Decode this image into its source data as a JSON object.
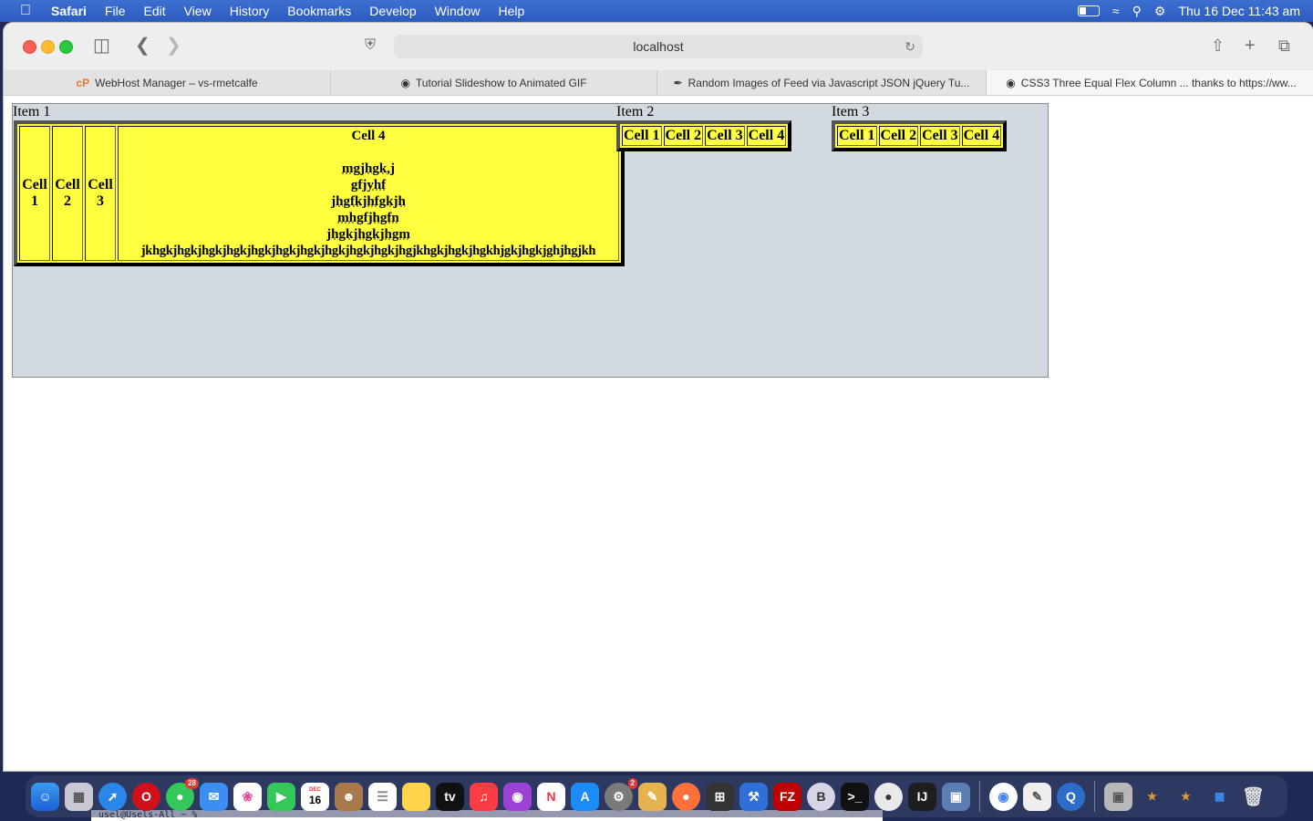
{
  "menubar": {
    "app": "Safari",
    "items": [
      "File",
      "Edit",
      "View",
      "History",
      "Bookmarks",
      "Develop",
      "Window",
      "Help"
    ],
    "clock": "Thu 16 Dec  11:43 am"
  },
  "toolbar": {
    "address": "localhost"
  },
  "tabs": [
    {
      "label": "WebHost Manager – vs-rmetcalfe",
      "favicon": "cP"
    },
    {
      "label": "Tutorial Slideshow to Animated GIF",
      "favicon": "github-icon"
    },
    {
      "label": "Random Images of Feed via Javascript JSON jQuery Tu...",
      "favicon": "feather-icon"
    },
    {
      "label": "CSS3 Three Equal Flex Column ... thanks to https://ww...",
      "favicon": "github-icon"
    }
  ],
  "page": {
    "columns": [
      {
        "label": "Item 1",
        "cells": [
          "Cell 1",
          "Cell 2",
          "Cell 3"
        ],
        "cell4_title": "Cell 4",
        "cell4_lines": [
          "mgjhgk,j",
          "gfjyhf",
          "jhgfkjhfgkjh",
          "mhgfjhgfn",
          "jhgkjhgkjhgm",
          "jkhgkjhgkjhgkjhgkjhgkjhgkjhgkjhgkjhgkjhgkjhgjkhgkjhgkjhgkhjgkjhgkjghjhgjkh"
        ]
      },
      {
        "label": "Item 2",
        "cells": [
          "Cell 1",
          "Cell 2",
          "Cell 3",
          "Cell 4"
        ]
      },
      {
        "label": "Item 3",
        "cells": [
          "Cell 1",
          "Cell 2",
          "Cell 3",
          "Cell 4"
        ]
      }
    ]
  },
  "dock": {
    "messages_badge": "28",
    "calendar_month": "DEC",
    "calendar_day": "16",
    "settings_badge": "2",
    "terminal_strip": "usel@Usels-All ~ %"
  },
  "colors": {
    "cell_fill": "#ffff3f",
    "flex_container": "#d3d9e0",
    "menubar": "#2c5bbf"
  }
}
